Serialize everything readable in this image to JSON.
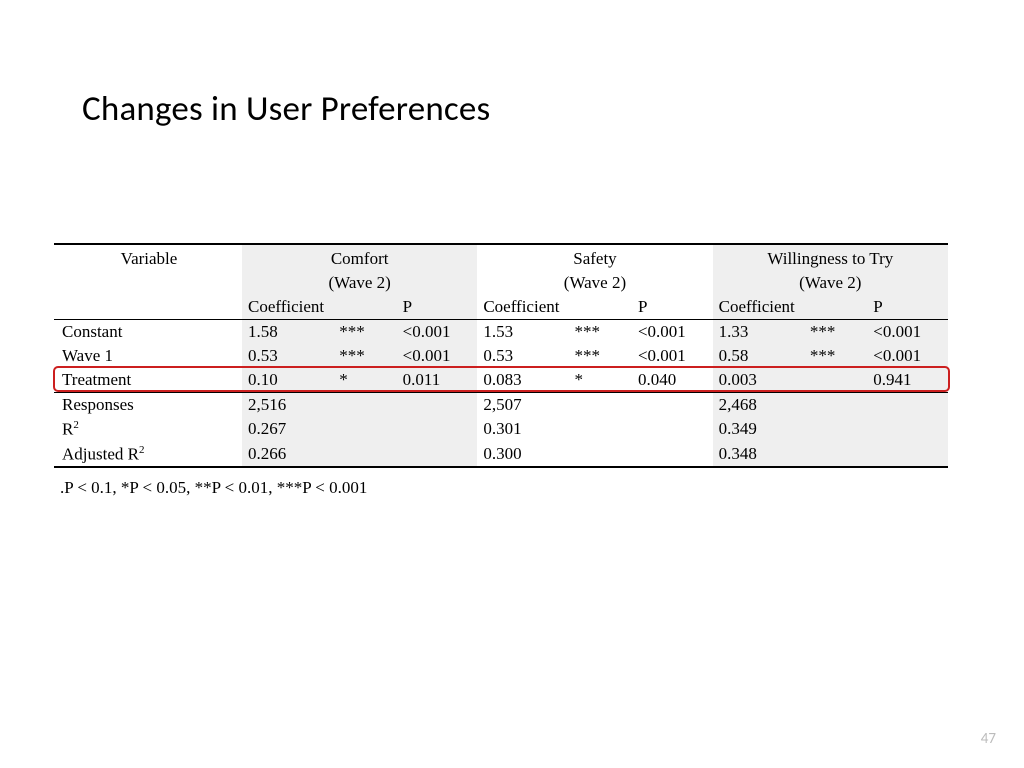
{
  "title": "Changes in User Preferences",
  "page_number": "47",
  "footnote": ".P < 0.1, *P < 0.05, **P < 0.01, ***P < 0.001",
  "headers": {
    "variable": "Variable",
    "groups": [
      {
        "name": "Comfort",
        "sub": "(Wave 2)"
      },
      {
        "name": "Safety",
        "sub": "(Wave 2)"
      },
      {
        "name": "Willingness to Try",
        "sub": "(Wave 2)"
      }
    ],
    "sub_cols": {
      "coef": "Coefficient",
      "p": "P"
    }
  },
  "rows": [
    {
      "label": "Constant",
      "c1_coef": "1.58",
      "c1_sig": "***",
      "c1_p": "<0.001",
      "s_coef": "1.53",
      "s_sig": "***",
      "s_p": "<0.001",
      "w_coef": "1.33",
      "w_sig": "***",
      "w_p": "<0.001"
    },
    {
      "label": "Wave 1",
      "c1_coef": "0.53",
      "c1_sig": "***",
      "c1_p": "<0.001",
      "s_coef": "0.53",
      "s_sig": "***",
      "s_p": "<0.001",
      "w_coef": "0.58",
      "w_sig": "***",
      "w_p": "<0.001"
    },
    {
      "label": "Treatment",
      "c1_coef": "0.10",
      "c1_sig": "*",
      "c1_p": "0.011",
      "s_coef": "0.083",
      "s_sig": "*",
      "s_p": "0.040",
      "w_coef": "0.003",
      "w_sig": "",
      "w_p": "0.941"
    }
  ],
  "summary": [
    {
      "label": "Responses",
      "c1": "2,516",
      "s": "2,507",
      "w": "2,468"
    },
    {
      "label_html": "R2",
      "c1": "0.267",
      "s": "0.301",
      "w": "0.349"
    },
    {
      "label_html": "Adjusted R2",
      "c1": "0.266",
      "s": "0.300",
      "w": "0.348"
    }
  ],
  "chart_data": {
    "type": "table",
    "title": "Changes in User Preferences — regression results (Wave 2)",
    "dependent_vars": [
      "Comfort (Wave 2)",
      "Safety (Wave 2)",
      "Willingness to Try (Wave 2)"
    ],
    "rows": [
      {
        "variable": "Constant",
        "Comfort": {
          "coef": 1.58,
          "sig": "***",
          "p": "<0.001"
        },
        "Safety": {
          "coef": 1.53,
          "sig": "***",
          "p": "<0.001"
        },
        "Willingness": {
          "coef": 1.33,
          "sig": "***",
          "p": "<0.001"
        }
      },
      {
        "variable": "Wave 1",
        "Comfort": {
          "coef": 0.53,
          "sig": "***",
          "p": "<0.001"
        },
        "Safety": {
          "coef": 0.53,
          "sig": "***",
          "p": "<0.001"
        },
        "Willingness": {
          "coef": 0.58,
          "sig": "***",
          "p": "<0.001"
        }
      },
      {
        "variable": "Treatment",
        "Comfort": {
          "coef": 0.1,
          "sig": "*",
          "p": 0.011
        },
        "Safety": {
          "coef": 0.083,
          "sig": "*",
          "p": 0.04
        },
        "Willingness": {
          "coef": 0.003,
          "sig": "",
          "p": 0.941
        }
      }
    ],
    "fit": {
      "Responses": {
        "Comfort": 2516,
        "Safety": 2507,
        "Willingness": 2468
      },
      "R2": {
        "Comfort": 0.267,
        "Safety": 0.301,
        "Willingness": 0.349
      },
      "Adjusted_R2": {
        "Comfort": 0.266,
        "Safety": 0.3,
        "Willingness": 0.348
      }
    },
    "significance_key": ".P < 0.1, *P < 0.05, **P < 0.01, ***P < 0.001",
    "highlighted_row": "Treatment"
  }
}
